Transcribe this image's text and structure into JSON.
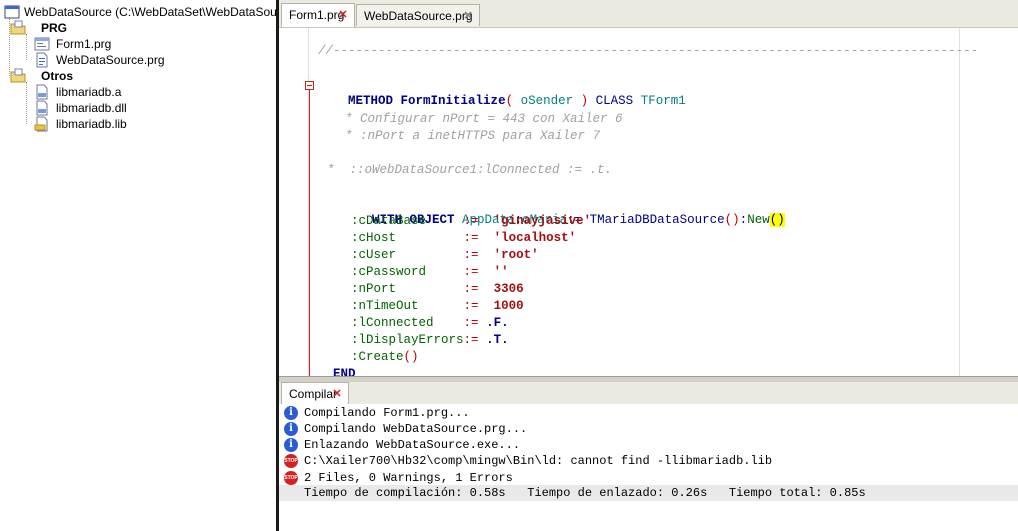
{
  "tree": {
    "root_label": "WebDataSource  (C:\\WebDataSet\\WebDataSource",
    "groups": [
      {
        "label": "PRG",
        "items": [
          "Form1.prg",
          "WebDataSource.prg"
        ]
      },
      {
        "label": "Otros",
        "items": [
          "libmariadb.a",
          "libmariadb.dll",
          "libmariadb.lib"
        ]
      }
    ]
  },
  "tabs": [
    {
      "label": "Form1.prg",
      "active": true
    },
    {
      "label": "WebDataSource.prg",
      "active": false
    }
  ],
  "editor": {
    "lines": [
      "//--------------------------------------------------------------------------------------",
      "METHOD FormInitialize( oSender ) CLASS TForm1",
      "* Configurar nPort = 443 con Xailer 6",
      "* :nPort a inetHTTPS para Xailer 7",
      "*  ::oWebDataSource1:lConnected := .t.",
      "WITH OBJECT AppData:oMaria:= TMariaDBDataSource():New()",
      ":cDataBase     :=  'ginayjasive'",
      ":cHost         :=  'localhost'",
      ":cUser         :=  'root'",
      ":cPassword     :=  ''",
      ":nPort         :=  3306",
      ":nTimeOut      :=  1000",
      ":lConnected    := .F.",
      ":lDisplayErrors:= .T.",
      ":Create()",
      "END"
    ]
  },
  "output": {
    "tab_label": "Compilar",
    "lines": [
      {
        "type": "info",
        "text": "Compilando Form1.prg..."
      },
      {
        "type": "info",
        "text": "Compilando WebDataSource.prg..."
      },
      {
        "type": "info",
        "text": "Enlazando WebDataSource.exe..."
      },
      {
        "type": "error",
        "text": "C:\\Xailer700\\Hb32\\comp\\mingw\\Bin\\ld: cannot find -llibmariadb.lib"
      },
      {
        "type": "error",
        "text": "2 Files, 0 Warnings, 1 Errors"
      },
      {
        "type": "none",
        "text": "Tiempo de compilación: 0.58s   Tiempo de enlazado: 0.26s   Tiempo total: 0.85s"
      }
    ],
    "error_icon_text": "STOP",
    "info_icon_text": "i"
  },
  "colors": {
    "keyword": "#00008b",
    "string": "#a01010",
    "comment": "#a0a0a0",
    "error": "#d42020",
    "info": "#2a5bd7"
  },
  "icons": {
    "root": "window-icon",
    "folder": "folder-icon",
    "prg": "form-file-icon",
    "lib": "library-file-icon",
    "close": "close-icon"
  }
}
